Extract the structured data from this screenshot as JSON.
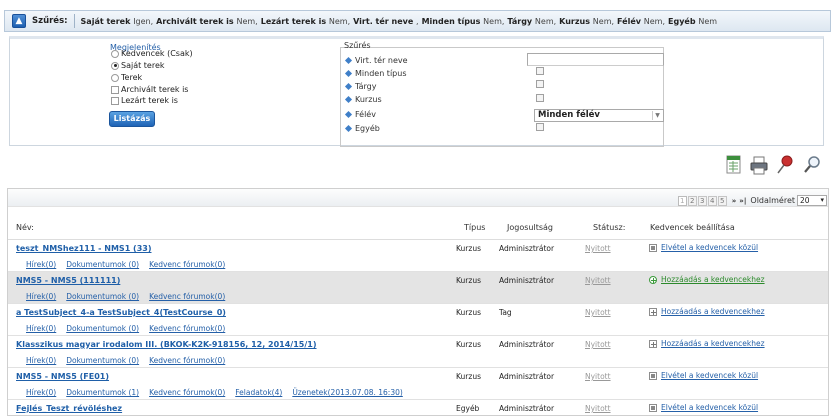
{
  "filter_summary": {
    "title": "Szűrés:",
    "items": [
      {
        "label": "Saját terek",
        "value": "Igen,"
      },
      {
        "label": "Archivált terek is",
        "value": "Nem,"
      },
      {
        "label": "Lezárt terek is",
        "value": "Nem,"
      },
      {
        "label": "Virt. tér neve",
        "value": ","
      },
      {
        "label": "Minden típus",
        "value": "Nem,"
      },
      {
        "label": "Tárgy",
        "value": "Nem,"
      },
      {
        "label": "Kurzus",
        "value": "Nem,"
      },
      {
        "label": "Félév",
        "value": "Nem,"
      },
      {
        "label": "Egyéb",
        "value": "Nem"
      }
    ]
  },
  "display": {
    "legend": "Megjelenítés",
    "options": [
      {
        "label": "Kedvencek (Csak)",
        "kind": "radio",
        "checked": false
      },
      {
        "label": "Saját terek",
        "kind": "radio",
        "checked": true
      },
      {
        "label": "Terek",
        "kind": "radio",
        "checked": false
      },
      {
        "label": "Archivált terek is",
        "kind": "checkbox",
        "checked": false
      },
      {
        "label": "Lezárt terek is",
        "kind": "checkbox",
        "checked": false
      }
    ],
    "list_button": "Listázás"
  },
  "filters": {
    "legend": "Szűrés",
    "rows": [
      {
        "label": "Virt. tér neve",
        "control": "text",
        "value": ""
      },
      {
        "label": "Minden típus",
        "control": "checkbox"
      },
      {
        "label": "Tárgy",
        "control": "checkbox"
      },
      {
        "label": "Kurzus",
        "control": "checkbox"
      },
      {
        "label": "Félév",
        "control": "select",
        "value": "Minden félév"
      },
      {
        "label": "Egyéb",
        "control": "checkbox"
      }
    ]
  },
  "toolbar": {
    "icons": [
      "excel-export-icon",
      "print-icon",
      "pin-icon",
      "search-icon"
    ]
  },
  "pager": {
    "pages": [
      "1",
      "2",
      "3",
      "4",
      "5"
    ],
    "next": "»",
    "last": "»|",
    "page_size_label": "Oldalméret",
    "page_size": "20"
  },
  "table": {
    "headers": {
      "name": "Név:",
      "type": "Típus",
      "perm": "Jogosultság",
      "status": "Státusz:",
      "fav": "Kedvencek beállítása"
    },
    "rows": [
      {
        "name": "teszt_NMShez111 - NMS1 (33)",
        "links": [
          "Hírek(0)",
          "Dokumentumok (0)",
          "Kedvenc fórumok(0)"
        ],
        "type": "Kurzus",
        "perm": "Adminisztrátor",
        "status": "Nyitott",
        "fav": "Elvétel a kedvencek közül",
        "fav_kind": "remove",
        "highlight": false
      },
      {
        "name": "NMS5 - NMS5 (111111)",
        "links": [
          "Hírek(0)",
          "Dokumentumok (0)",
          "Kedvenc fórumok(0)"
        ],
        "type": "Kurzus",
        "perm": "Adminisztrátor",
        "status": "Nyitott",
        "fav": "Hozzáadás a kedvencekhez",
        "fav_kind": "add-hover",
        "highlight": true
      },
      {
        "name": "a TestSubject_4-a TestSubject_4(TestCourse_0)",
        "links": [
          "Hírek(0)",
          "Dokumentumok (0)",
          "Kedvenc fórumok(0)"
        ],
        "type": "Kurzus",
        "perm": "Tag",
        "status": "Nyitott",
        "fav": "Hozzáadás a kedvencekhez",
        "fav_kind": "add",
        "highlight": false
      },
      {
        "name": "Klasszikus magyar irodalom III. (BKOK-K2K-918156, 12, 2014/15/1)",
        "links": [
          "Hírek(0)",
          "Dokumentumok (0)",
          "Kedvenc fórumok(0)"
        ],
        "type": "Kurzus",
        "perm": "Adminisztrátor",
        "status": "Nyitott",
        "fav": "Hozzáadás a kedvencekhez",
        "fav_kind": "add",
        "highlight": false
      },
      {
        "name": "NMS5 - NMS5 (FE01)",
        "links": [
          "Hírek(0)",
          "Dokumentumok (1)",
          "Kedvenc fórumok(0)",
          "Feladatok(4)",
          "Üzenetek(2013.07.08. 16:30)"
        ],
        "type": "Kurzus",
        "perm": "Adminisztrátor",
        "status": "Nyitott",
        "fav": "Elvétel a kedvencek közül",
        "fav_kind": "remove",
        "highlight": false
      },
      {
        "name": "Fejlés_Teszt_révöléshez",
        "links": [],
        "type": "Egyéb",
        "perm": "Adminisztrátor",
        "status": "Nyitott",
        "fav": "Elvétel a kedvencek közül",
        "fav_kind": "remove",
        "highlight": false
      }
    ]
  }
}
